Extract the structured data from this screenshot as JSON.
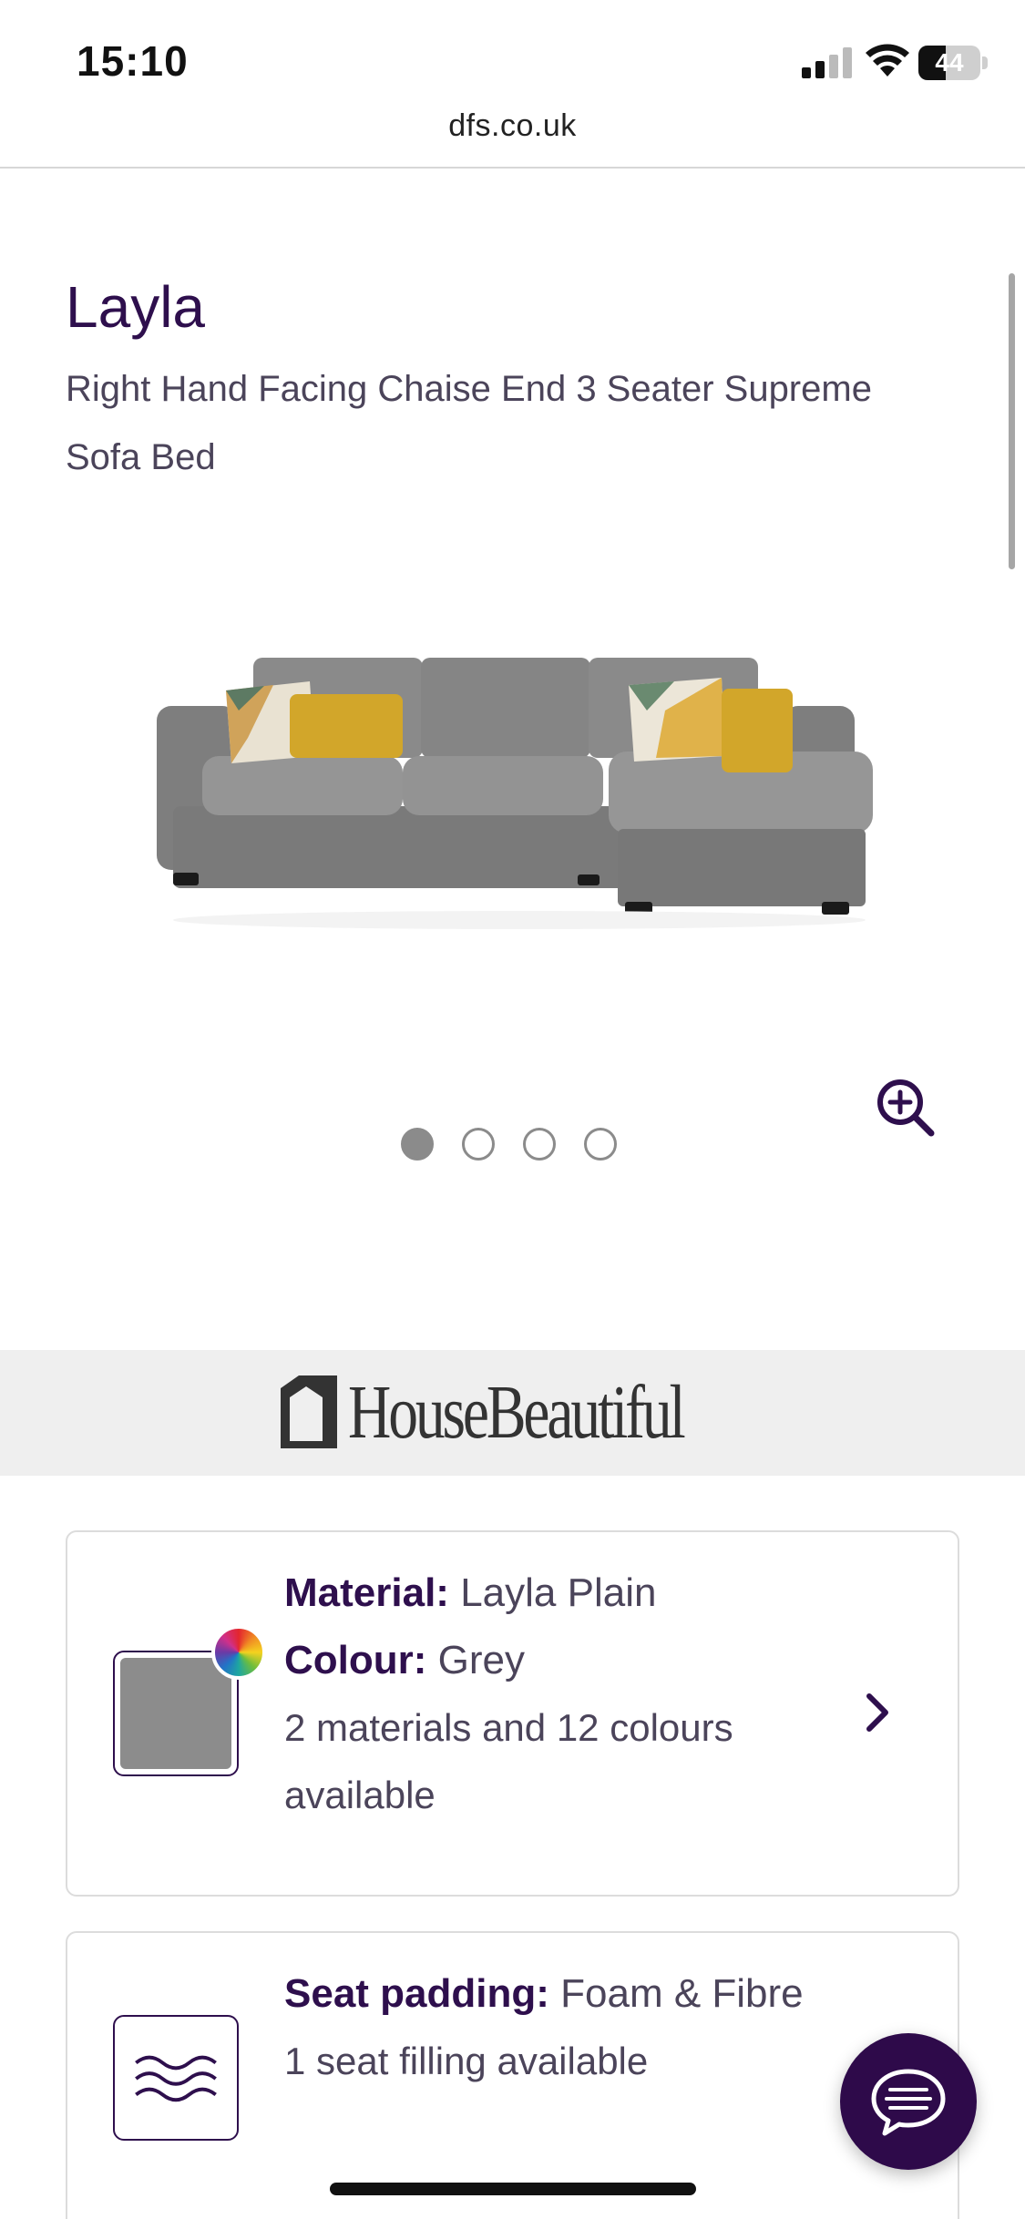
{
  "status_bar": {
    "time": "15:10",
    "battery_level": "44",
    "battery_percent": 44
  },
  "browser": {
    "url": "dfs.co.uk"
  },
  "product": {
    "name": "Layla",
    "description": "Right Hand Facing Chaise End 3 Seater Supreme Sofa Bed",
    "gallery": {
      "image_count": 4,
      "active_index": 0
    }
  },
  "partner": {
    "name": "HouseBeautiful"
  },
  "options": {
    "material": {
      "material_label": "Material:",
      "material_value": "Layla Plain",
      "colour_label": "Colour:",
      "colour_value": "Grey",
      "availability": "2 materials and 12 colours available",
      "swatch_color": "#8c8c8c"
    },
    "seat_padding": {
      "label": "Seat padding:",
      "value": "Foam & Fibre",
      "availability": "1 seat filling available"
    }
  },
  "colors": {
    "brand_purple": "#2e0f4d",
    "chat_button": "#2e0a4a",
    "band_grey": "#efefef"
  },
  "icons": {
    "zoom": "zoom-in-icon",
    "chevron": "chevron-right-icon",
    "chat": "chat-icon",
    "padding": "waves-icon"
  }
}
